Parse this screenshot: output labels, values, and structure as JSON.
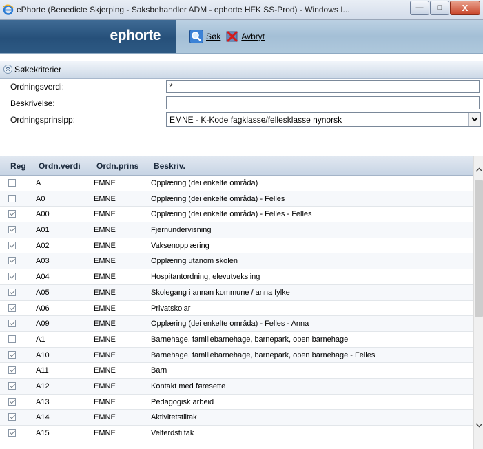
{
  "window": {
    "title": "ePhorte (Benedicte Skjerping - Saksbehandler ADM - ephorte HFK SS-Prod) - Windows I...",
    "minimize_glyph": "—",
    "maximize_glyph": "□",
    "close_glyph": "X"
  },
  "app": {
    "logo": "ephorte",
    "toolbar": {
      "search_label": "Søk",
      "cancel_label": "Avbryt"
    }
  },
  "section": {
    "title": "Søkekriterier"
  },
  "form": {
    "ordningsverdi_label": "Ordningsverdi:",
    "ordningsverdi_value": "*",
    "beskrivelse_label": "Beskrivelse:",
    "beskrivelse_value": "",
    "ordningsprinsipp_label": "Ordningsprinsipp:",
    "ordningsprinsipp_value": "EMNE - K-Kode fagklasse/fellesklasse nynorsk"
  },
  "grid": {
    "headers": {
      "reg": "Reg",
      "ordnverdi": "Ordn.verdi",
      "ordnprins": "Ordn.prins",
      "beskriv": "Beskriv."
    },
    "rows": [
      {
        "reg": false,
        "ordnverdi": "A",
        "ordnprins": "EMNE",
        "beskriv": "Opplæring (dei enkelte områda)"
      },
      {
        "reg": false,
        "ordnverdi": "A0",
        "ordnprins": "EMNE",
        "beskriv": "Opplæring (dei enkelte områda) - Felles"
      },
      {
        "reg": true,
        "ordnverdi": "A00",
        "ordnprins": "EMNE",
        "beskriv": "Opplæring (dei enkelte områda) - Felles - Felles"
      },
      {
        "reg": true,
        "ordnverdi": "A01",
        "ordnprins": "EMNE",
        "beskriv": "Fjernundervisning"
      },
      {
        "reg": true,
        "ordnverdi": "A02",
        "ordnprins": "EMNE",
        "beskriv": "Vaksenopplæring"
      },
      {
        "reg": true,
        "ordnverdi": "A03",
        "ordnprins": "EMNE",
        "beskriv": "Opplæring utanom skolen"
      },
      {
        "reg": true,
        "ordnverdi": "A04",
        "ordnprins": "EMNE",
        "beskriv": "Hospitantordning, elevutveksling"
      },
      {
        "reg": true,
        "ordnverdi": "A05",
        "ordnprins": "EMNE",
        "beskriv": "Skolegang i annan kommune / anna fylke"
      },
      {
        "reg": true,
        "ordnverdi": "A06",
        "ordnprins": "EMNE",
        "beskriv": "Privatskolar"
      },
      {
        "reg": true,
        "ordnverdi": "A09",
        "ordnprins": "EMNE",
        "beskriv": "Opplæring (dei enkelte områda) - Felles - Anna"
      },
      {
        "reg": false,
        "ordnverdi": "A1",
        "ordnprins": "EMNE",
        "beskriv": "Barnehage, familiebarnehage, barnepark, open barnehage"
      },
      {
        "reg": true,
        "ordnverdi": "A10",
        "ordnprins": "EMNE",
        "beskriv": "Barnehage, familiebarnehage, barnepark, open barnehage - Felles"
      },
      {
        "reg": true,
        "ordnverdi": "A11",
        "ordnprins": "EMNE",
        "beskriv": "Barn"
      },
      {
        "reg": true,
        "ordnverdi": "A12",
        "ordnprins": "EMNE",
        "beskriv": "Kontakt med føresette"
      },
      {
        "reg": true,
        "ordnverdi": "A13",
        "ordnprins": "EMNE",
        "beskriv": "Pedagogisk arbeid"
      },
      {
        "reg": true,
        "ordnverdi": "A14",
        "ordnprins": "EMNE",
        "beskriv": "Aktivitetstiltak"
      },
      {
        "reg": true,
        "ordnverdi": "A15",
        "ordnprins": "EMNE",
        "beskriv": "Velferdstiltak"
      }
    ]
  }
}
